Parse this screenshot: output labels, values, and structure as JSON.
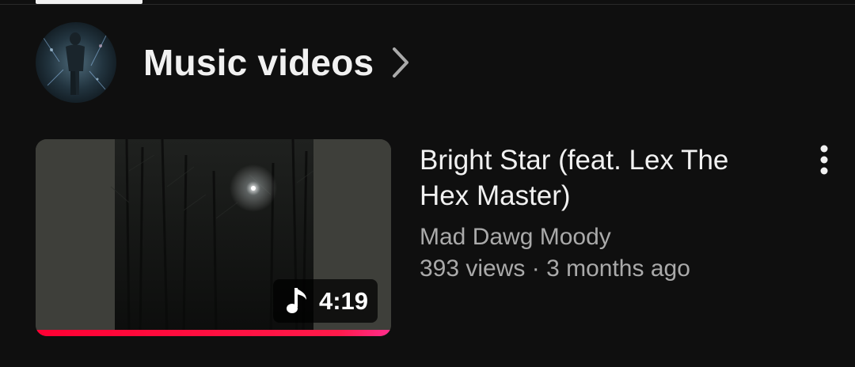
{
  "shelf": {
    "title": "Music videos",
    "avatar_icon": "channel-avatar",
    "chevron_icon": "chevron-right-icon"
  },
  "video": {
    "title": "Bright Star (feat. Lex The Hex Master)",
    "channel": "Mad Dawg Moody",
    "views": "393 views",
    "separator": "·",
    "age": "3 months ago",
    "duration": "4:19",
    "badge_icon": "music-note-icon",
    "menu_icon": "more-vert-icon",
    "watched_fraction": 1.0
  },
  "colors": {
    "background": "#0f0f0f",
    "progress": "#ff0033",
    "text_primary": "#f1f1f1",
    "text_secondary": "#aaaaaa"
  }
}
